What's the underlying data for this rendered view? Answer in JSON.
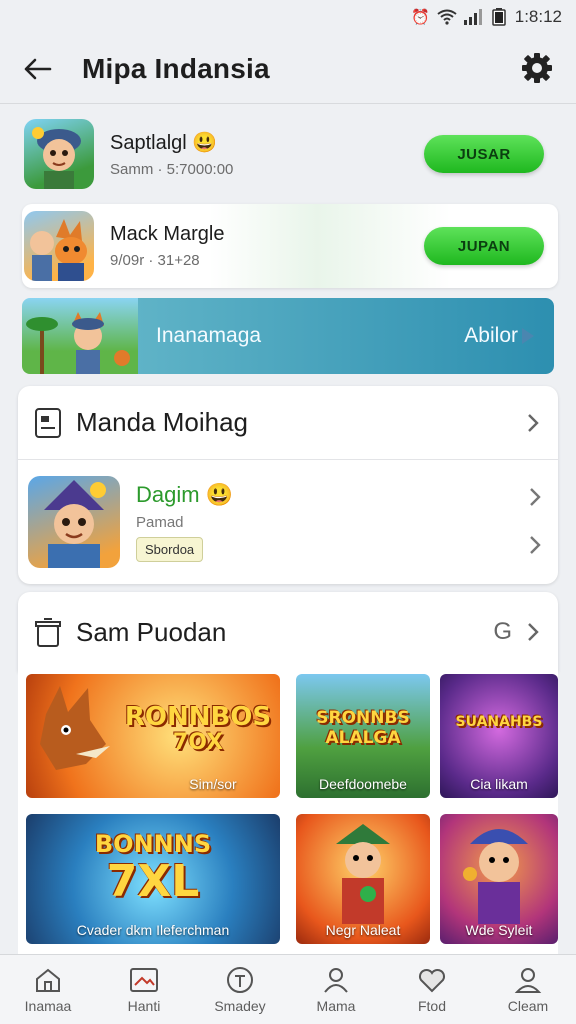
{
  "status_bar": {
    "time": "1:8:12",
    "icons": [
      "alarm-icon",
      "wifi-icon",
      "signal-icon",
      "battery-icon"
    ]
  },
  "header": {
    "title": "Mipa Indansia"
  },
  "games": [
    {
      "name": "Saptlalgl",
      "subtitle": "Samm · 5:7000:00",
      "button": "JUSAR"
    },
    {
      "name": "Mack Margle",
      "subtitle": "9/09r · 31+28",
      "button": "JUPAN"
    }
  ],
  "banner": {
    "text": "Inanamaga",
    "action": "Abilor"
  },
  "section1": {
    "title": "Manda Moihag",
    "item": {
      "name": "Dagim",
      "subtitle": "Pamad",
      "badge": "Sbordoa"
    }
  },
  "section2": {
    "title": "Sam Puodan",
    "count": "G",
    "tiles": [
      {
        "headline": "RONNBOS",
        "num": "7OX",
        "label": "Sim/sor"
      },
      {
        "headline": "SRONNBS ALALGA",
        "label": "Deefdoomebe"
      },
      {
        "headline": "SUANAHBS",
        "label": "Cia likam"
      },
      {
        "headline": "BONNNS",
        "num": "7XL",
        "label": "Cvader dkm Ileferchman"
      },
      {
        "label": "Negr Naleat"
      },
      {
        "label": "Wde Syleit"
      }
    ]
  },
  "nav": [
    {
      "label": "Inamaa",
      "icon": "home-icon"
    },
    {
      "label": "Hanti",
      "icon": "image-icon"
    },
    {
      "label": "Smadey",
      "icon": "tag-icon"
    },
    {
      "label": "Mama",
      "icon": "people-icon"
    },
    {
      "label": "Ftod",
      "icon": "heart-icon"
    },
    {
      "label": "Cleam",
      "icon": "profile-icon"
    }
  ],
  "colors": {
    "accent_green": "#2ec72a",
    "banner_blue": "#3a9fbd",
    "title_green": "#2c9a2c"
  }
}
